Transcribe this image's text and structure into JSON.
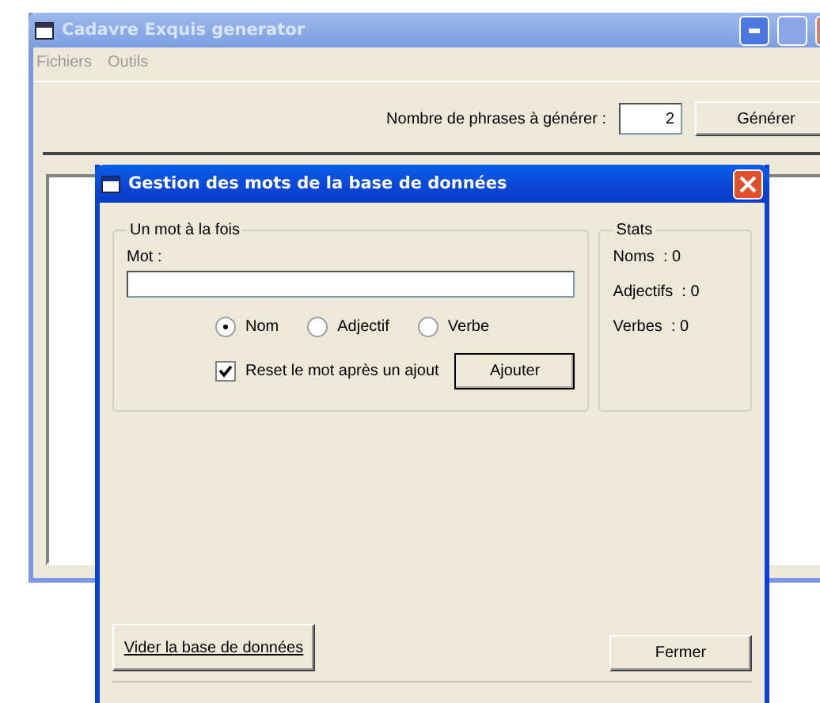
{
  "main_window": {
    "title": "Cadavre Exquis generator",
    "active": false,
    "menu": [
      "Fichiers",
      "Outils"
    ],
    "count_label": "Nombre de phrases à générer :",
    "count_value": "2",
    "generate_button": "Générer"
  },
  "dialog": {
    "title": "Gestion des mots de la base de données",
    "active": true,
    "word_group": {
      "title": "Un mot à la fois",
      "word_label": "Mot :",
      "types": [
        {
          "label": "Nom",
          "selected": true
        },
        {
          "label": "Adjectif",
          "selected": false
        },
        {
          "label": "Verbe",
          "selected": false
        }
      ],
      "reset_checkbox": {
        "label": "Reset le mot après un ajout",
        "checked": true
      },
      "add_button": "Ajouter"
    },
    "stats": {
      "title": "Stats",
      "items": [
        "Noms  : 0",
        "Adjectifs  : 0",
        "Verbes  : 0"
      ]
    },
    "clear_button": "Vider la base de données",
    "close_button": "Fermer"
  }
}
